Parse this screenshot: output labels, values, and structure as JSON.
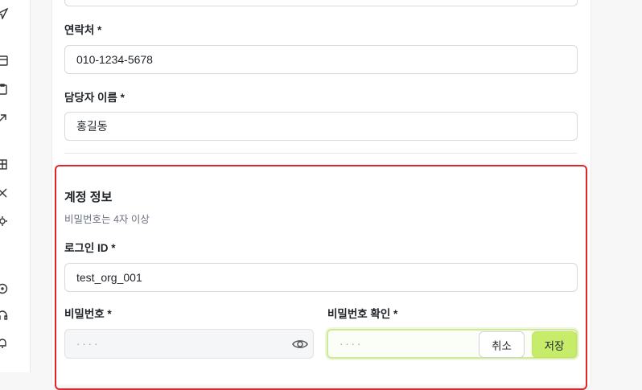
{
  "sidebar": {
    "icons": [
      "send-icon",
      "calendar-icon",
      "clipboard-icon",
      "arrow-up-right-icon",
      "building-icon",
      "tools-icon",
      "gear-icon",
      "help-icon",
      "headset-icon",
      "bell-icon"
    ]
  },
  "form": {
    "contact": {
      "label": "연락처 *",
      "value": "010-1234-5678"
    },
    "manager": {
      "label": "담당자 이름 *",
      "value": "홍길동"
    }
  },
  "account": {
    "title": "계정 정보",
    "hint": "비밀번호는 4자 이상",
    "login_id": {
      "label": "로그인 ID *",
      "value": "test_org_001"
    },
    "password": {
      "label": "비밀번호 *",
      "value": "····"
    },
    "password_confirm": {
      "label": "비밀번호 확인 *",
      "value": "····"
    }
  },
  "buttons": {
    "cancel": "취소",
    "save": "저장"
  },
  "colors": {
    "accent_border": "#e0252b",
    "save_button": "#c7ec6a"
  }
}
